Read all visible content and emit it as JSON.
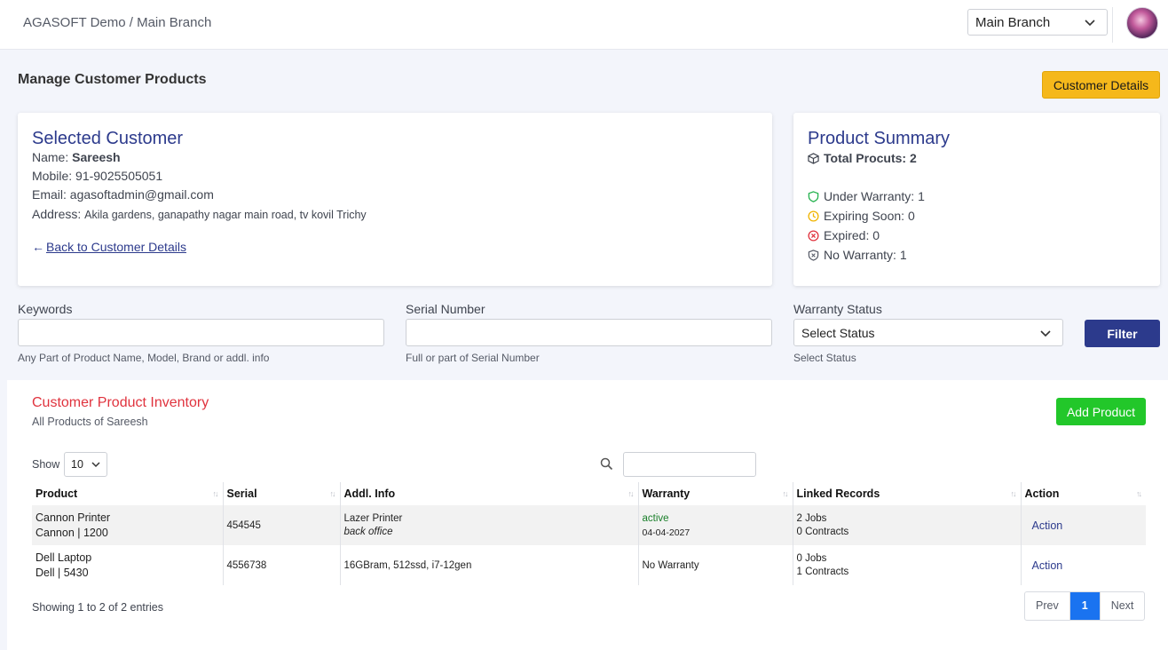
{
  "header": {
    "breadcrumb": "AGASOFT Demo / Main Branch",
    "branch_select": "Main Branch"
  },
  "page": {
    "title": "Manage Customer Products",
    "customer_details_button": "Customer Details"
  },
  "customer": {
    "heading": "Selected Customer",
    "name_label": "Name:",
    "name": "Sareesh",
    "mobile_label": "Mobile:",
    "mobile": "91-9025505051",
    "email_label": "Email:",
    "email": "agasoftadmin@gmail.com",
    "address_label": "Address:",
    "address": "Akila gardens, ganapathy nagar main road, tv kovil Trichy",
    "back_link": "Back to Customer Details"
  },
  "summary": {
    "heading": "Product Summary",
    "total": "Total Procuts: 2",
    "under_warranty": "Under Warranty: 1",
    "expiring_soon": "Expiring Soon: 0",
    "expired": "Expired: 0",
    "no_warranty": "No Warranty: 1",
    "colors": {
      "under": "#22b14c",
      "expiring": "#f0b400",
      "expired": "#e0333e",
      "none": "#555a66"
    }
  },
  "filters": {
    "keywords_label": "Keywords",
    "keywords_help": "Any Part of Product Name, Model, Brand or addl. info",
    "serial_label": "Serial Number",
    "serial_help": "Full or part of Serial Number",
    "status_label": "Warranty Status",
    "status_value": "Select Status",
    "status_help": "Select Status",
    "filter_button": "Filter"
  },
  "inventory": {
    "title": "Customer Product Inventory",
    "subtitle": "All Products of Sareesh",
    "add_button": "Add Product",
    "show_label": "Show",
    "show_value": "10",
    "columns": [
      "Product",
      "Serial",
      "Addl. Info",
      "Warranty",
      "Linked Records",
      "Action"
    ],
    "rows": [
      {
        "product_name": "Cannon Printer",
        "product_model": "Cannon | 1200",
        "serial": "454545",
        "info_main": "Lazer Printer",
        "info_sub": "back office",
        "warranty_status": "active",
        "warranty_date": "04-04-2027",
        "jobs": "2 Jobs",
        "contracts": "0 Contracts",
        "action": "Action"
      },
      {
        "product_name": "Dell Laptop",
        "product_model": "Dell | 5430",
        "serial": "4556738",
        "info_main": "16GBram, 512ssd, i7-12gen",
        "info_sub": "",
        "warranty_status": "No Warranty",
        "warranty_date": "",
        "jobs": "0 Jobs",
        "contracts": "1 Contracts",
        "action": "Action"
      }
    ],
    "entries_text": "Showing 1 to 2 of 2 entries",
    "pager": {
      "prev": "Prev",
      "current": "1",
      "next": "Next"
    }
  }
}
